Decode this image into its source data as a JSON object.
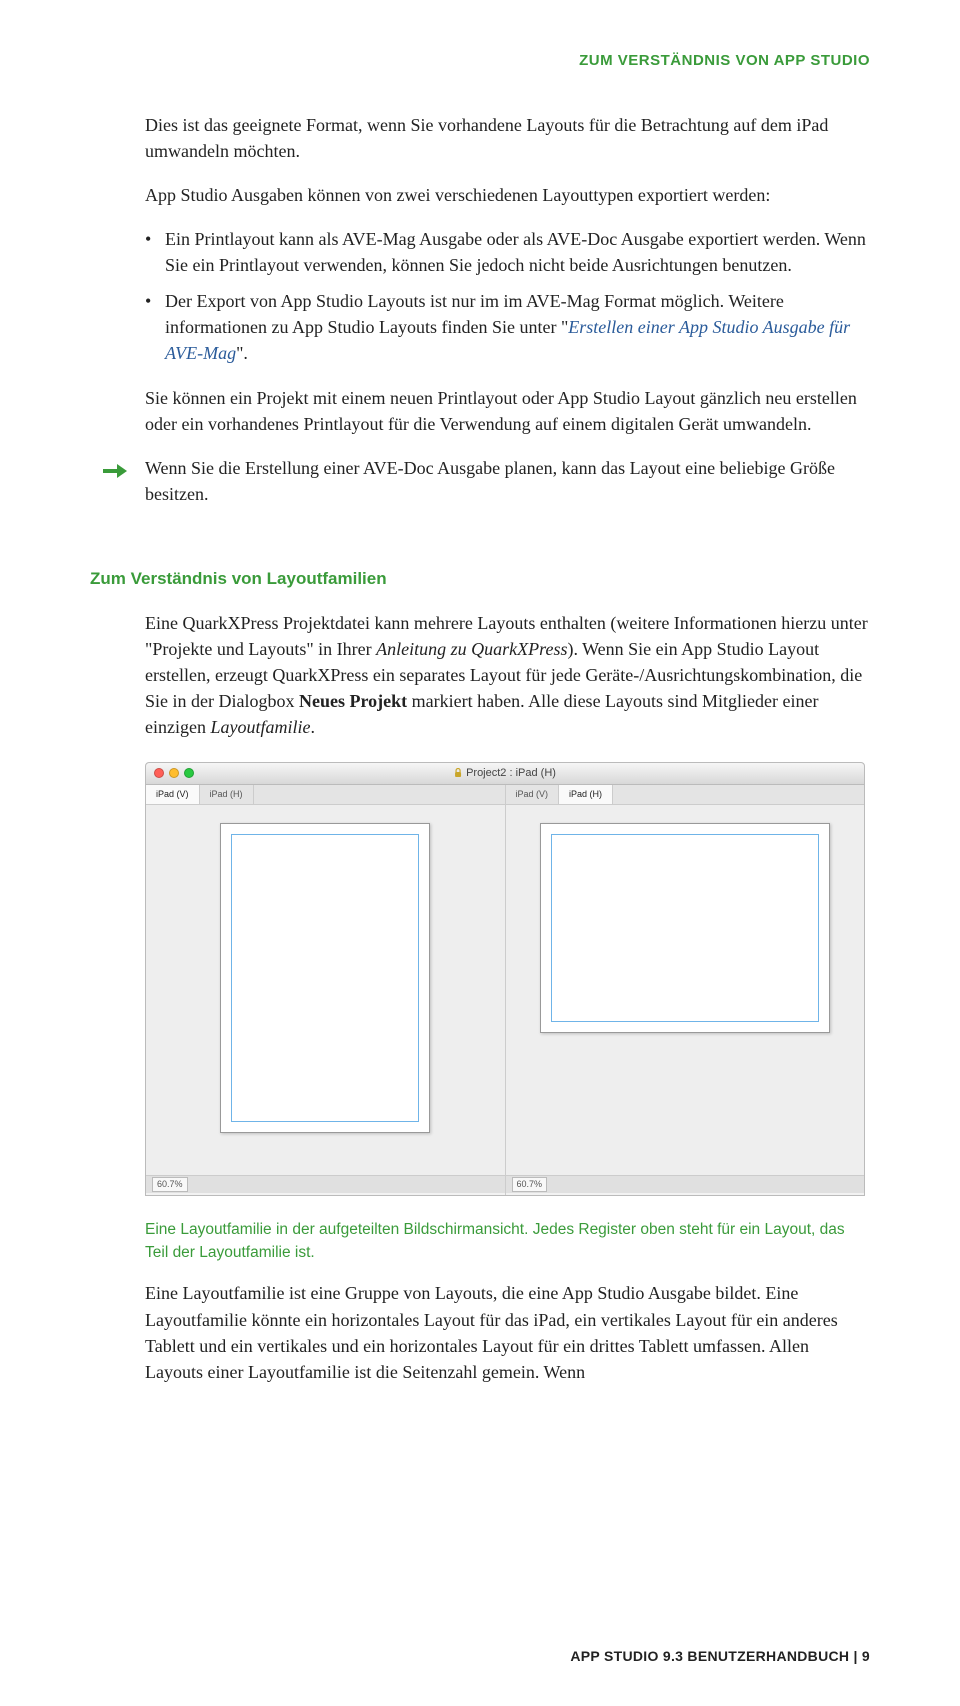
{
  "header": {
    "running_title": "ZUM VERSTÄNDNIS VON APP STUDIO"
  },
  "intro": {
    "p1": "Dies ist das geeignete Format, wenn Sie vorhandene Layouts für die Betrachtung auf dem iPad umwandeln möchten.",
    "p2": "App Studio Ausgaben können von zwei verschiedenen Layouttypen exportiert werden:"
  },
  "bullets": {
    "b1": "Ein Printlayout kann als AVE-Mag Ausgabe oder als AVE-Doc Ausgabe exportiert werden. Wenn Sie ein Printlayout verwenden, können Sie jedoch nicht beide Ausrichtungen benutzen.",
    "b2a": "Der Export von App Studio Layouts ist nur im im AVE-Mag Format möglich. Weitere informationen zu App Studio Layouts finden Sie unter \"",
    "b2link": "Erstellen einer App Studio Ausgabe für AVE-Mag",
    "b2c": "\"."
  },
  "after_bullets": {
    "p": "Sie können ein Projekt mit einem neuen Printlayout oder App Studio Layout gänzlich neu erstellen oder ein vorhandenes Printlayout für die Verwendung auf einem digitalen Gerät umwandeln."
  },
  "note": {
    "text": "Wenn Sie die Erstellung einer AVE-Doc Ausgabe planen, kann das Layout eine beliebige Größe besitzen."
  },
  "section": {
    "heading": "Zum Verständnis von Layoutfamilien",
    "p1a": "Eine QuarkXPress Projektdatei kann mehrere Layouts enthalten (weitere Informationen hierzu unter \"Projekte und Layouts\" in Ihrer ",
    "p1link": "Anleitung zu QuarkXPress",
    "p1b": "). Wenn Sie ein App Studio Layout erstellen, erzeugt QuarkXPress ein separates Layout für jede Geräte-/Ausrichtungskombination, die Sie in der Dialogbox ",
    "p1bold": "Neues Projekt",
    "p1c": " markiert haben. Alle diese Layouts sind Mitglieder einer einzigen ",
    "p1italic": "Layoutfamilie",
    "p1d": "."
  },
  "screenshot": {
    "window_title": "Project2 : iPad (H)",
    "left": {
      "tab1": "iPad (V)",
      "tab2": "iPad (H)",
      "zoom": "60.7%"
    },
    "right": {
      "tab1": "iPad (V)",
      "tab2": "iPad (H)",
      "zoom": "60.7%"
    }
  },
  "caption": {
    "text": "Eine Layoutfamilie in der aufgeteilten Bildschirmansicht. Jedes Register oben steht für ein Layout, das Teil der Layoutfamilie ist."
  },
  "closing": {
    "p": "Eine Layoutfamilie ist eine Gruppe von Layouts, die eine App Studio Ausgabe bildet. Eine Layoutfamilie könnte ein horizontales Layout für das iPad, ein vertikales Layout für ein anderes Tablett und ein vertikales und ein horizontales Layout für ein drittes Tablett umfassen. Allen Layouts einer Layoutfamilie ist die Seitenzahl gemein. Wenn"
  },
  "footer": {
    "text": "APP STUDIO 9.3 BENUTZERHANDBUCH | 9"
  }
}
